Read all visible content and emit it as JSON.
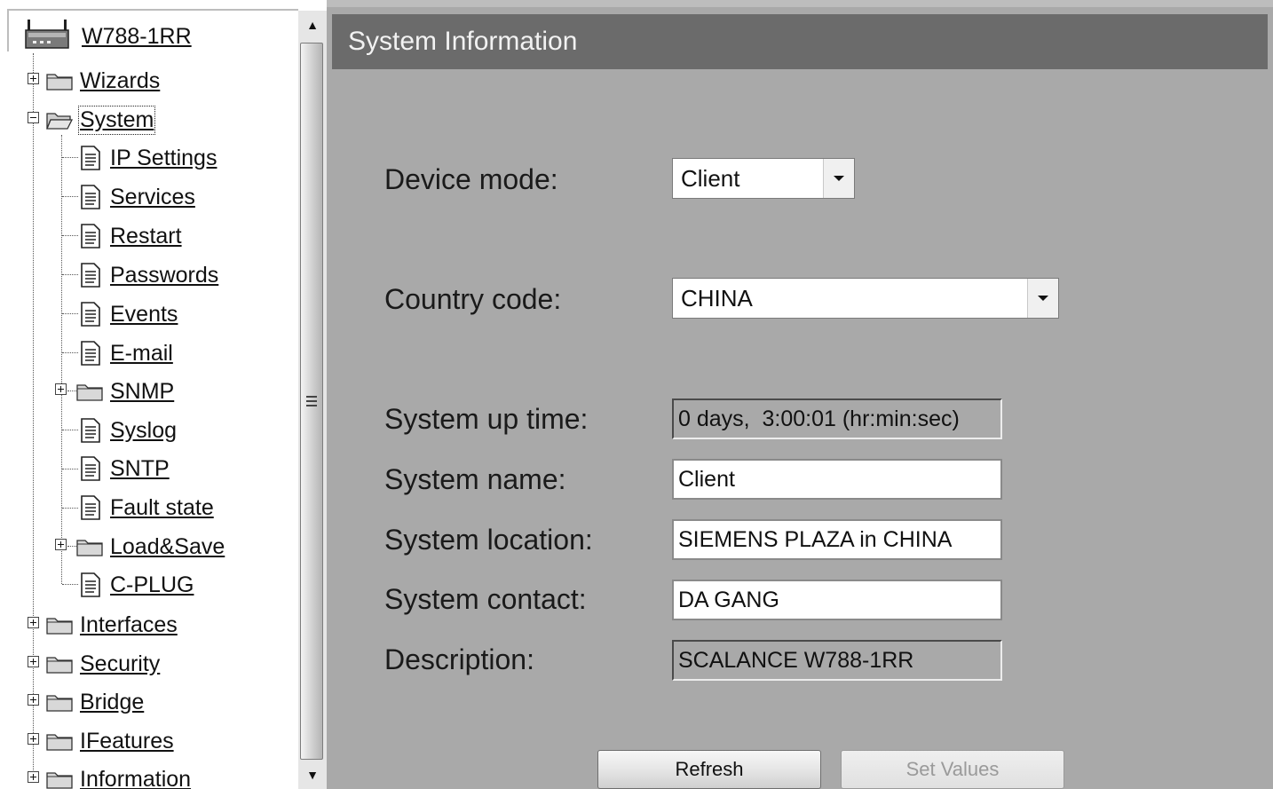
{
  "tree": {
    "root": {
      "label": "W788-1RR",
      "icon": "access-point-device-icon"
    },
    "items": [
      {
        "label": "Wizards",
        "type": "folder",
        "state": "collapsed"
      },
      {
        "label": "System",
        "type": "folder",
        "state": "expanded",
        "selected": true
      },
      {
        "label": "IP Settings",
        "type": "page"
      },
      {
        "label": "Services",
        "type": "page"
      },
      {
        "label": "Restart",
        "type": "page"
      },
      {
        "label": "Passwords",
        "type": "page"
      },
      {
        "label": "Events",
        "type": "page"
      },
      {
        "label": "E-mail",
        "type": "page"
      },
      {
        "label": "SNMP",
        "type": "folder",
        "state": "collapsed"
      },
      {
        "label": "Syslog",
        "type": "page"
      },
      {
        "label": "SNTP",
        "type": "page"
      },
      {
        "label": "Fault state",
        "type": "page"
      },
      {
        "label": "Load&Save",
        "type": "folder",
        "state": "collapsed"
      },
      {
        "label": "C-PLUG",
        "type": "page"
      },
      {
        "label": "Interfaces",
        "type": "folder",
        "state": "collapsed"
      },
      {
        "label": "Security",
        "type": "folder",
        "state": "collapsed"
      },
      {
        "label": "Bridge",
        "type": "folder",
        "state": "collapsed"
      },
      {
        "label": "IFeatures",
        "type": "folder",
        "state": "collapsed"
      },
      {
        "label": "Information",
        "type": "folder",
        "state": "collapsed"
      }
    ]
  },
  "panel": {
    "title": "System Information"
  },
  "form": {
    "device_mode": {
      "label": "Device mode:",
      "value": "Client"
    },
    "country_code": {
      "label": "Country code:",
      "value": "CHINA"
    },
    "uptime": {
      "label": "System up time:",
      "value": "0 days,  3:00:01 (hr:min:sec)"
    },
    "system_name": {
      "label": "System name:",
      "value": "Client"
    },
    "system_location": {
      "label": "System location:",
      "value": "SIEMENS PLAZA in CHINA"
    },
    "system_contact": {
      "label": "System contact:",
      "value": "DA GANG"
    },
    "description": {
      "label": "Description:",
      "value": "SCALANCE W788-1RR"
    }
  },
  "buttons": {
    "refresh": "Refresh",
    "set_values": "Set Values"
  },
  "colors": {
    "panel_bg": "#a9a9a9",
    "header_bg": "#6b6b6b",
    "header_text": "#f2f2f2"
  }
}
